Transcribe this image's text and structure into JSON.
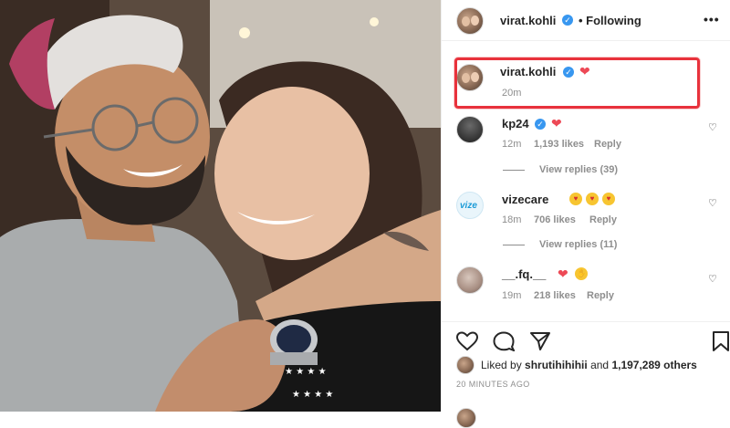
{
  "header": {
    "username": "virat.kohli",
    "follow_status": "• Following",
    "more_label": "•••"
  },
  "caption": {
    "username": "virat.kohli",
    "time": "20m"
  },
  "comments": [
    {
      "username": "kp24",
      "emojis": [
        "heart-emoji"
      ],
      "time": "12m",
      "likes": "1,193 likes",
      "reply": "Reply",
      "view_replies": "View replies (39)",
      "avatar": "kp24-avatar"
    },
    {
      "username": "vizecare",
      "emojis": [
        "heart-eyes-emoji",
        "heart-eyes-emoji",
        "heart-eyes-emoji"
      ],
      "time": "18m",
      "likes": "706 likes",
      "reply": "Reply",
      "view_replies": "View replies (11)",
      "avatar": "vizecare-avatar",
      "avatar_text": "vize"
    },
    {
      "username": "__.fq.__",
      "emojis": [
        "heart-emoji",
        "raised-hands-emoji"
      ],
      "time": "19m",
      "likes": "218 likes",
      "reply": "Reply",
      "avatar": "fq-avatar"
    }
  ],
  "footer": {
    "liked_by_prefix": "Liked by",
    "liked_by_user": "shrutihihihii",
    "liked_by_and": "and",
    "liked_by_count": "1,197,289 others",
    "time_ago": "20 MINUTES AGO"
  },
  "colors": {
    "verified": "#3897f0",
    "heart": "#ed4956",
    "highlight": "#e8323c"
  }
}
